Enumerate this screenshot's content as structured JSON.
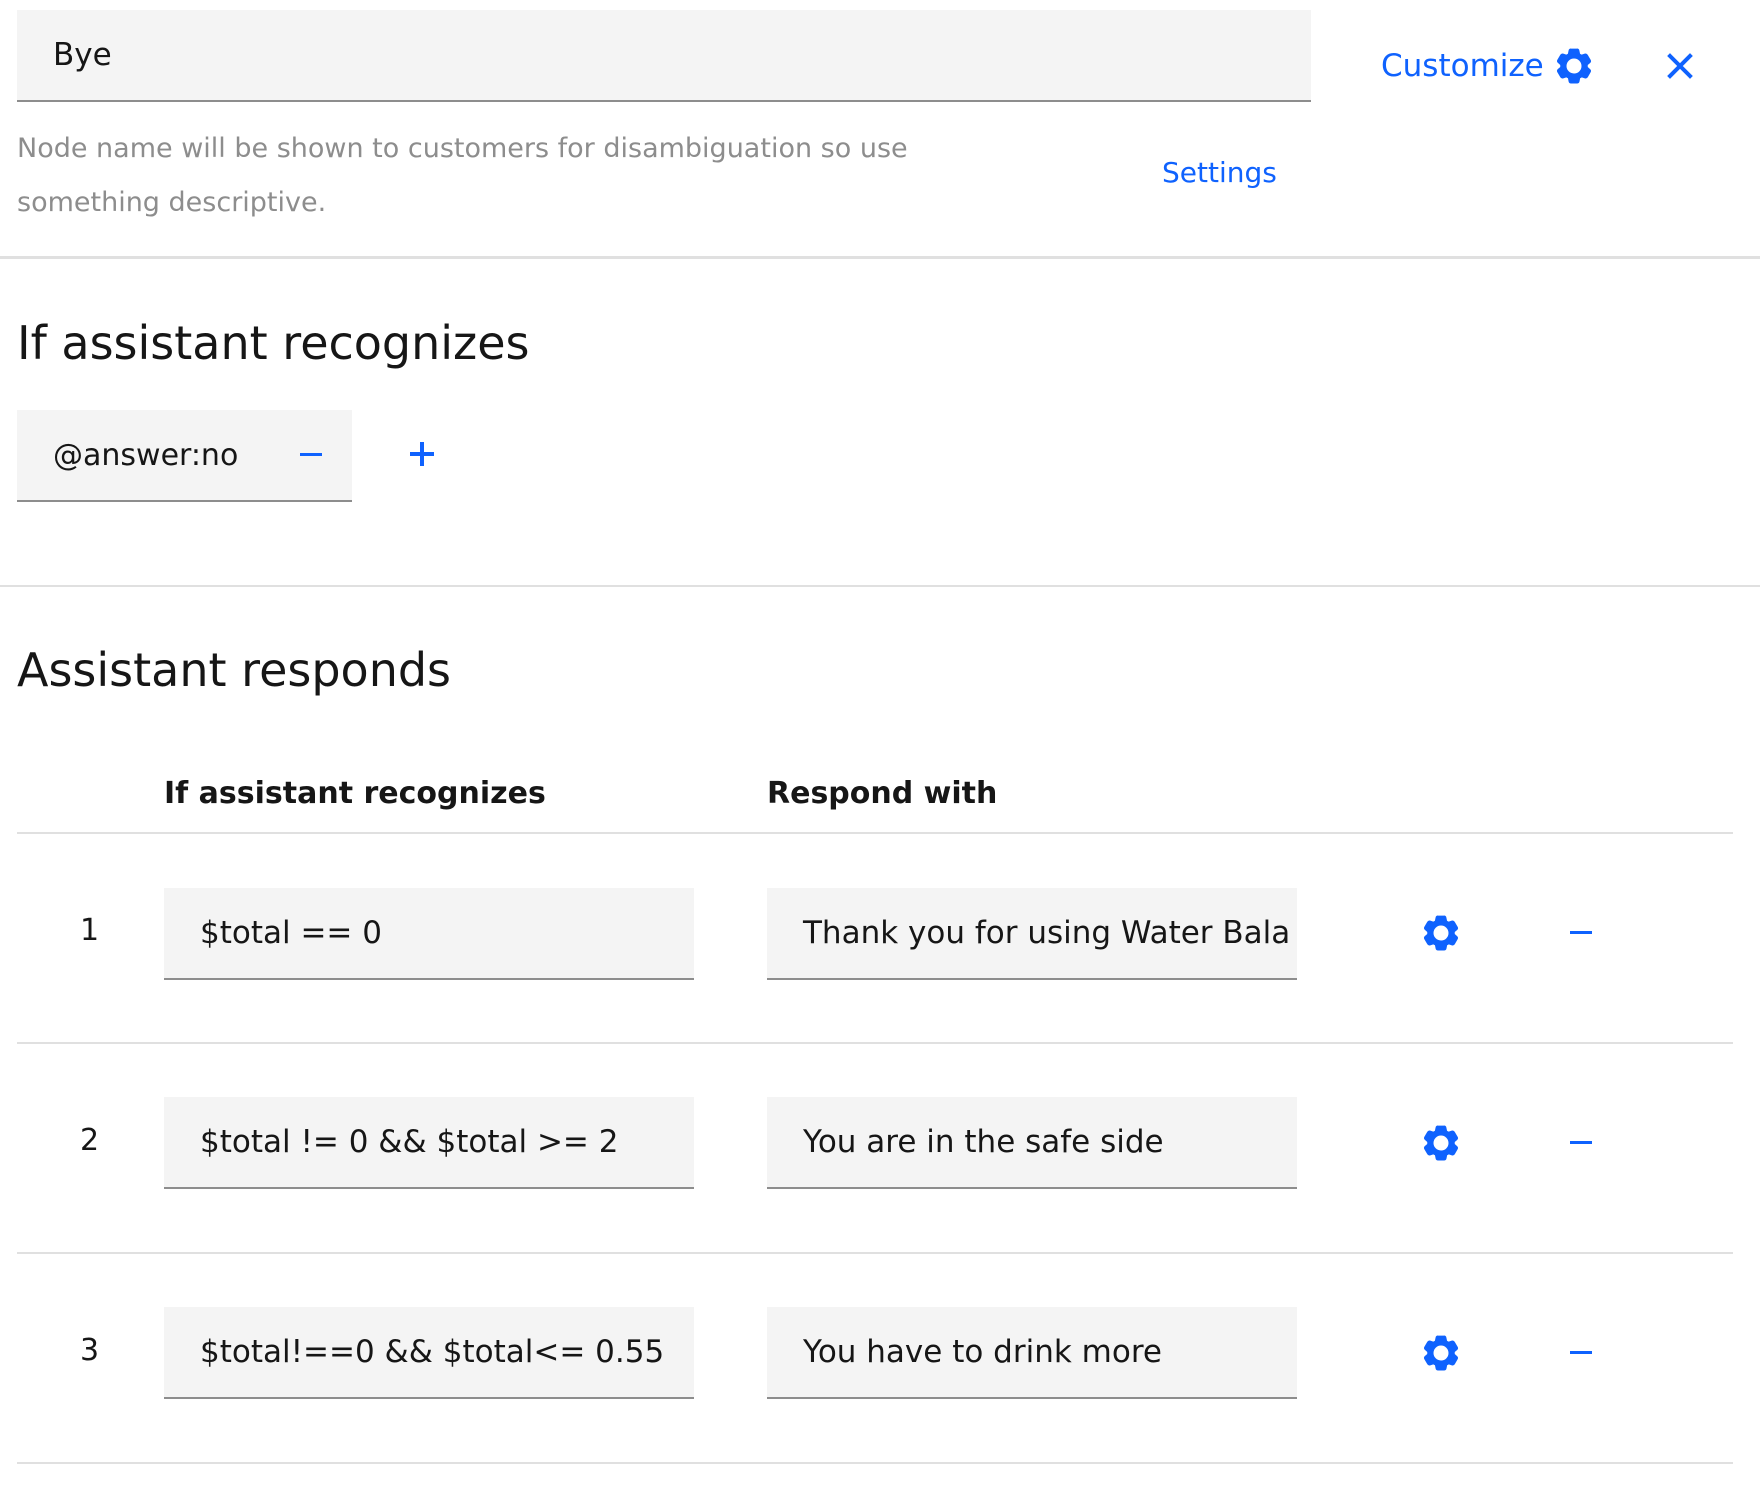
{
  "node": {
    "name_value": "Bye",
    "helper_text": "Node name will be shown to customers for disambiguation so use something descriptive.",
    "settings_label": "Settings",
    "customize_label": "Customize"
  },
  "condition": {
    "heading": "If assistant recognizes",
    "tag": "@answer:no"
  },
  "responds": {
    "heading": "Assistant responds",
    "col_condition": "If assistant recognizes",
    "col_response": "Respond with",
    "rows": [
      {
        "num": "1",
        "condition": "$total ==  0",
        "response": "Thank you for using Water Bala"
      },
      {
        "num": "2",
        "condition": "$total != 0 && $total >= 2",
        "response": "You are in the safe side"
      },
      {
        "num": "3",
        "condition": "$total!==0 && $total<= 0.55",
        "response": "You have to drink more"
      }
    ]
  },
  "icons": {
    "customize": "gear-icon",
    "close": "close-icon",
    "add": "plus-icon",
    "remove": "minus-icon",
    "row_settings": "gear-icon"
  },
  "colors": {
    "accent": "#0f62fe",
    "field_bg": "#f4f4f4",
    "text": "#161616",
    "muted": "#8d8d8d"
  }
}
